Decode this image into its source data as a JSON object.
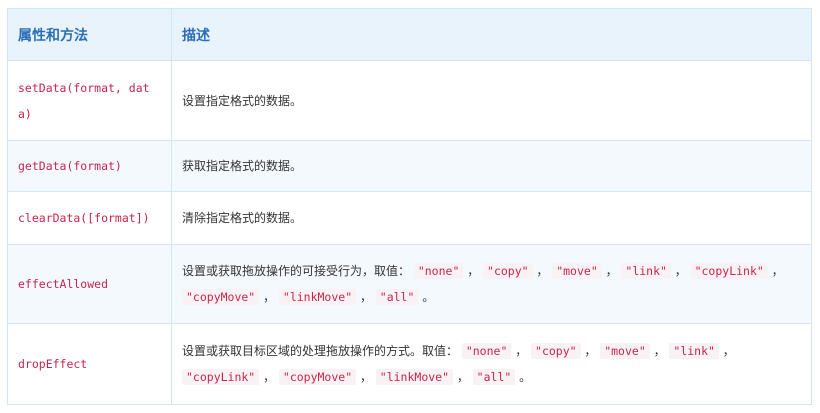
{
  "table": {
    "headers": [
      "属性和方法",
      "描述"
    ],
    "rows": [
      {
        "member": "setData(format, data)",
        "description": [
          {
            "t": "设置指定格式的数据。"
          }
        ]
      },
      {
        "member": "getData(format)",
        "description": [
          {
            "t": "获取指定格式的数据。"
          }
        ]
      },
      {
        "member": "clearData([format])",
        "description": [
          {
            "t": "清除指定格式的数据。"
          }
        ]
      },
      {
        "member": "effectAllowed",
        "description": [
          {
            "t": "设置或获取拖放操作的可接受行为，取值： "
          },
          {
            "c": "\"none\""
          },
          {
            "t": " ， "
          },
          {
            "c": "\"copy\""
          },
          {
            "t": " ， "
          },
          {
            "c": "\"move\""
          },
          {
            "t": " ， "
          },
          {
            "c": "\"link\""
          },
          {
            "t": " ， "
          },
          {
            "c": "\"copyLink\""
          },
          {
            "t": " ， "
          },
          {
            "c": "\"copyMove\""
          },
          {
            "t": " ， "
          },
          {
            "c": "\"linkMove\""
          },
          {
            "t": " ， "
          },
          {
            "c": "\"all\""
          },
          {
            "t": " 。"
          }
        ]
      },
      {
        "member": "dropEffect",
        "description": [
          {
            "t": "设置或获取目标区域的处理拖放操作的方式。取值： "
          },
          {
            "c": "\"none\""
          },
          {
            "t": " ， "
          },
          {
            "c": "\"copy\""
          },
          {
            "t": " ， "
          },
          {
            "c": "\"move\""
          },
          {
            "t": " ， "
          },
          {
            "c": "\"link\""
          },
          {
            "t": " ， "
          },
          {
            "c": "\"copyLink\""
          },
          {
            "t": " ， "
          },
          {
            "c": "\"copyMove\""
          },
          {
            "t": " ， "
          },
          {
            "c": "\"linkMove\""
          },
          {
            "t": " ， "
          },
          {
            "c": "\"all\""
          },
          {
            "t": " 。"
          }
        ]
      }
    ]
  },
  "colors": {
    "header_bg": "#e8f3fc",
    "header_text": "#2a6eb8",
    "border": "#d4e6f6",
    "stripe_bg": "#f4f9fe",
    "code_text": "#c7254e",
    "code_bg": "#f9f2f4"
  }
}
